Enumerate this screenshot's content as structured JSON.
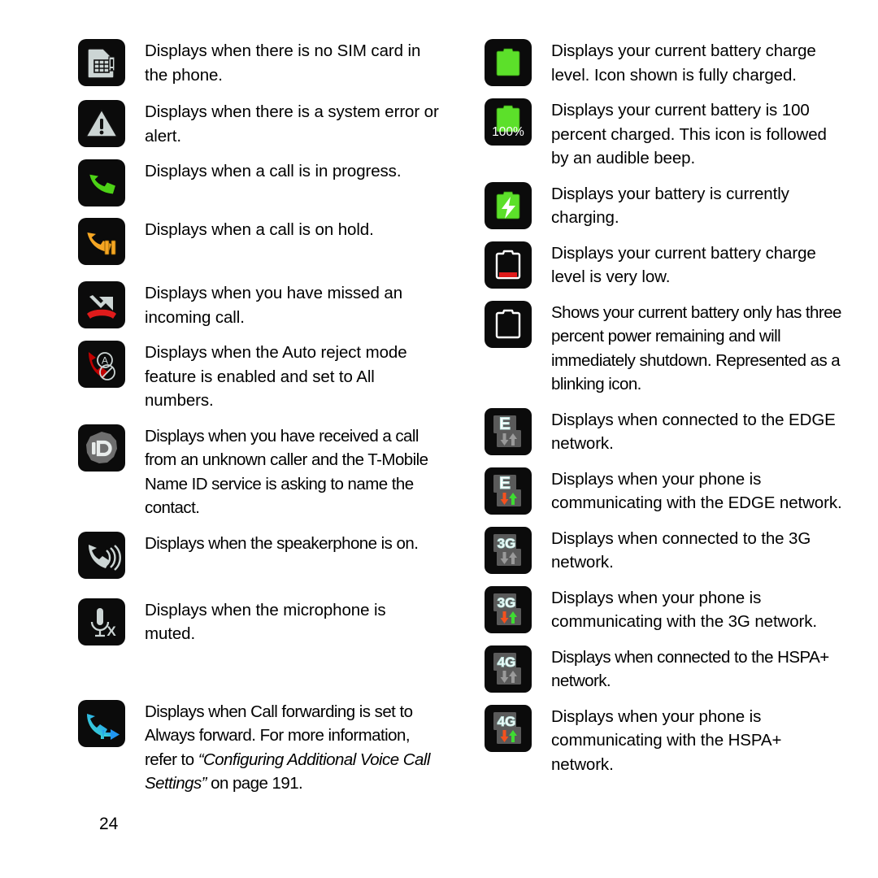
{
  "page": {
    "number": "24"
  },
  "left_column": [
    {
      "icon": "no-sim-card-icon",
      "text": "Displays when there is no SIM card in the phone.",
      "tight": false,
      "gap_after": 16
    },
    {
      "icon": "system-error-alert-icon",
      "text": "Displays when there is a system error or alert.",
      "tight": false,
      "gap_after": 14
    },
    {
      "icon": "call-in-progress-icon",
      "text": "Displays when a call is in progress.",
      "tight": false,
      "gap_after": 14
    },
    {
      "icon": "call-on-hold-icon",
      "text": "Displays when a call is on hold.",
      "tight": false,
      "gap_after": 20
    },
    {
      "icon": "missed-call-icon",
      "text": "Displays when you have missed an incoming call.",
      "tight": false,
      "gap_after": 14
    },
    {
      "icon": "auto-reject-all-icon",
      "text": "Displays when the Auto reject mode feature is enabled and set to All numbers.",
      "tight": false,
      "gap_after": 14
    },
    {
      "icon": "name-id-icon",
      "text": "Displays when you have received a call from an unknown caller and the T-Mobile Name ID service is asking to name the contact.",
      "tight": true,
      "gap_after": 14
    },
    {
      "icon": "speakerphone-on-icon",
      "text": "Displays when the speakerphone is on.",
      "tight": true,
      "gap_after": 24
    },
    {
      "icon": "microphone-muted-icon",
      "text": "Displays when the microphone is muted.",
      "tight": false,
      "gap_after": 66
    },
    {
      "icon": "call-forwarding-icon",
      "text_parts": [
        {
          "t": "Displays when Call forwarding is set to Always forward. For more information, refer to ",
          "style": "normal"
        },
        {
          "t": "“Configuring Additional Voice Call Settings”",
          "style": "italic"
        },
        {
          "t": "  on page 191.",
          "style": "normal"
        }
      ],
      "tight": true,
      "gap_after": 0
    }
  ],
  "right_column": [
    {
      "icon": "battery-full-icon",
      "text": "Displays your current battery charge level. Icon shown is fully charged.",
      "tight": false,
      "gap_after": 14
    },
    {
      "icon": "battery-100-percent-icon",
      "label": "100%",
      "text": "Displays your current battery is 100 percent charged. This icon is followed by an audible beep.",
      "tight": false,
      "gap_after": 14
    },
    {
      "icon": "battery-charging-icon",
      "text": "Displays your battery is currently charging.",
      "tight": false,
      "gap_after": 14
    },
    {
      "icon": "battery-very-low-icon",
      "text": "Displays your current battery charge level is very low.",
      "tight": false,
      "gap_after": 14
    },
    {
      "icon": "battery-empty-icon",
      "text": "Shows your current battery only has three percent power remaining and will immediately shutdown. Represented as a blinking icon.",
      "tight": true,
      "gap_after": 14
    },
    {
      "icon": "edge-connected-icon",
      "network": "E",
      "active": false,
      "text": "Displays when connected to the EDGE network.",
      "tight": false,
      "gap_after": 14
    },
    {
      "icon": "edge-active-icon",
      "network": "E",
      "active": true,
      "text": "Displays when your phone is communicating with the EDGE network.",
      "tight": false,
      "gap_after": 14
    },
    {
      "icon": "3g-connected-icon",
      "network": "3G",
      "active": false,
      "text": "Displays when connected to the 3G network.",
      "tight": false,
      "gap_after": 14
    },
    {
      "icon": "3g-active-icon",
      "network": "3G",
      "active": true,
      "text": "Displays when your phone is communicating with the 3G network.",
      "tight": false,
      "gap_after": 14
    },
    {
      "icon": "hspa-plus-connected-icon",
      "network": "4G",
      "active": false,
      "text": "Displays when connected to the HSPA+ network.",
      "tight": true,
      "gap_after": 14
    },
    {
      "icon": "hspa-plus-active-icon",
      "network": "4G",
      "active": true,
      "text": "Displays when your phone is communicating with the HSPA+ network.",
      "tight": false,
      "gap_after": 0
    }
  ],
  "colors": {
    "tile_background": "#0b0b0b",
    "green": "#4dd216",
    "bright_green": "#5ce02a",
    "amber": "#f5a623",
    "red": "#e01b1b",
    "dark_red": "#c00000",
    "light_gray": "#ccd5d4",
    "mid_gray": "#6e6e6e",
    "cyan": "#3fe0d0",
    "blue": "#2196f3",
    "orange": "#f4511e",
    "arrow_gray": "#9a9a9a",
    "network_plate": "#5a5a5a"
  }
}
